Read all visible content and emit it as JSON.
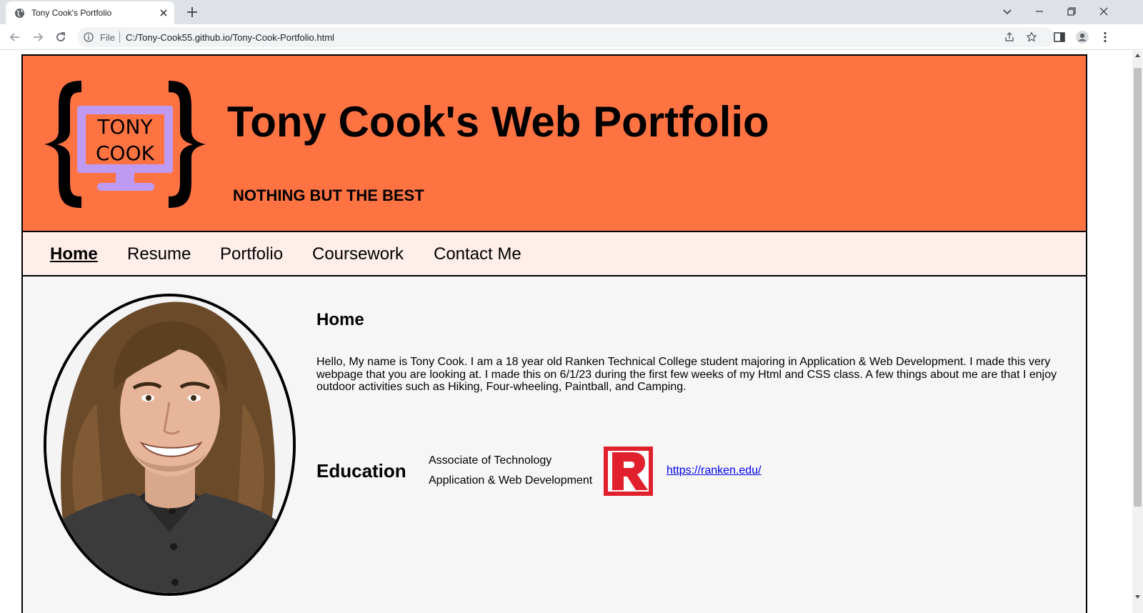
{
  "browser": {
    "tab_title": "Tony Cook's Portfolio",
    "file_label": "File",
    "url": "C:/Tony-Cook55.github.io/Tony-Cook-Portfolio.html"
  },
  "site": {
    "logo_line1": "TONY",
    "logo_line2": "COOK",
    "title": "Tony Cook's Web Portfolio",
    "tagline": "NOTHING BUT THE BEST"
  },
  "nav": {
    "items": [
      {
        "label": "Home",
        "active": true
      },
      {
        "label": "Resume"
      },
      {
        "label": "Portfolio"
      },
      {
        "label": "Coursework"
      },
      {
        "label": "Contact Me"
      }
    ]
  },
  "home": {
    "heading": "Home",
    "paragraph": "Hello, My name is Tony Cook. I am a 18 year old Ranken Technical College student majoring in Application & Web Development. I made this very webpage that you are looking at. I made this on 6/1/23 during the first few weeks of my Html and CSS class. A few things about me are that I enjoy outdoor activities such as Hiking, Four-wheeling, Paintball, and Camping."
  },
  "education": {
    "heading": "Education",
    "degree": "Associate of Technology",
    "program": "Application & Web Development",
    "link": "https://ranken.edu/"
  },
  "colors": {
    "header_bg": "#ff7343",
    "nav_bg": "#ffeeea",
    "logo_monitor": "#bf9af2",
    "ranken_red": "#e0202d"
  }
}
